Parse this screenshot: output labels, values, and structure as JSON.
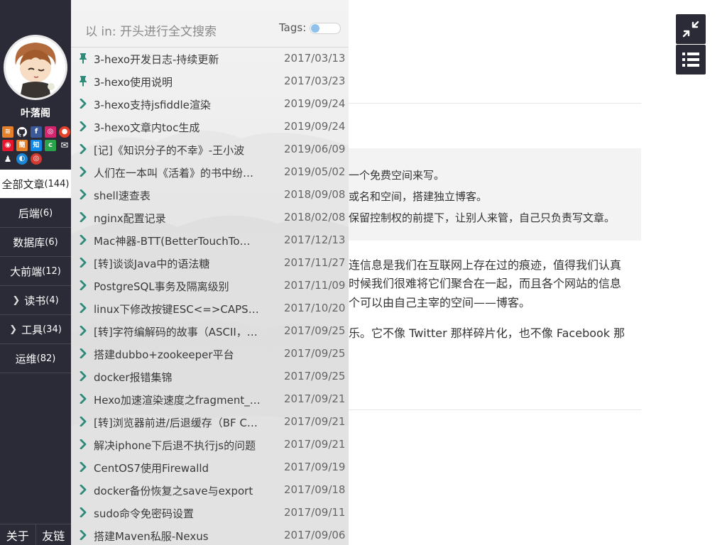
{
  "sidebar": {
    "site_name": "叶落阁",
    "social_row1": [
      {
        "icon": "rss-icon",
        "glyph": "≋",
        "color": "#e6802a"
      },
      {
        "icon": "github-icon",
        "glyph": "●",
        "color": "#2a2b36"
      },
      {
        "icon": "facebook-icon",
        "glyph": "f",
        "color": "#3b5998"
      },
      {
        "icon": "instagram-icon",
        "glyph": "◎",
        "color": "#d6256f"
      },
      {
        "icon": "reddit-icon",
        "glyph": "●",
        "color": "#e4422a"
      }
    ],
    "social_row2": [
      {
        "icon": "weibo-icon",
        "glyph": "◉",
        "color": "#e6162d"
      },
      {
        "icon": "douban-icon",
        "glyph": "簡",
        "color": "#e6802a"
      },
      {
        "icon": "zhihu-icon",
        "glyph": "知",
        "color": "#0f88eb"
      },
      {
        "icon": "csdn-icon",
        "glyph": "c",
        "color": "#2ba34b"
      },
      {
        "icon": "mail-icon",
        "glyph": "✉",
        "color": "#2a2b36"
      }
    ],
    "social_row3": [
      {
        "icon": "qq-icon",
        "glyph": "♟",
        "color": "#2a2b36"
      },
      {
        "icon": "segmentfault-icon",
        "glyph": "◐",
        "color": "#1b86d4"
      },
      {
        "icon": "netease-music-icon",
        "glyph": "◎",
        "color": "#d33a31"
      }
    ],
    "nav": [
      {
        "label": "全部文章",
        "count": "(144)",
        "active": true,
        "chevron": false
      },
      {
        "label": "后端",
        "count": "(6)",
        "active": false,
        "chevron": false
      },
      {
        "label": "数据库",
        "count": "(6)",
        "active": false,
        "chevron": false
      },
      {
        "label": "大前端",
        "count": "(12)",
        "active": false,
        "chevron": false
      },
      {
        "label": "读书",
        "count": "(4)",
        "active": false,
        "chevron": true
      },
      {
        "label": "工具",
        "count": "(34)",
        "active": false,
        "chevron": true
      },
      {
        "label": "运维",
        "count": "(82)",
        "active": false,
        "chevron": false
      }
    ],
    "bottom_links": [
      "关于",
      "友链"
    ]
  },
  "panel": {
    "search_placeholder": "以 in: 开头进行全文搜索",
    "tags_label": "Tags:",
    "tags_toggle_on": false,
    "posts": [
      {
        "title": "3-hexo开发日志-持续更新",
        "date": "2017/03/13",
        "pinned": true
      },
      {
        "title": "3-hexo使用说明",
        "date": "2017/03/23",
        "pinned": true
      },
      {
        "title": "3-hexo支持jsfiddle渲染",
        "date": "2019/09/24",
        "pinned": false
      },
      {
        "title": "3-hexo文章内toc生成",
        "date": "2019/09/24",
        "pinned": false
      },
      {
        "title": "[记]《知识分子的不幸》-王小波",
        "date": "2019/06/09",
        "pinned": false
      },
      {
        "title": "人们在一本叫《活着》的书中纷纷…",
        "date": "2019/05/02",
        "pinned": false
      },
      {
        "title": "shell速查表",
        "date": "2018/09/08",
        "pinned": false
      },
      {
        "title": "nginx配置记录",
        "date": "2018/02/08",
        "pinned": false
      },
      {
        "title": "Mac神器-BTT(BetterTouchTo…",
        "date": "2017/12/13",
        "pinned": false
      },
      {
        "title": "[转]谈谈Java中的语法糖",
        "date": "2017/11/27",
        "pinned": false
      },
      {
        "title": "PostgreSQL事务及隔离级别",
        "date": "2017/11/09",
        "pinned": false
      },
      {
        "title": "linux下修改按键ESC<=>CAPSL…",
        "date": "2017/10/20",
        "pinned": false
      },
      {
        "title": "[转]字符编解码的故事（ASCII，…",
        "date": "2017/09/25",
        "pinned": false
      },
      {
        "title": "搭建dubbo+zookeeper平台",
        "date": "2017/09/25",
        "pinned": false
      },
      {
        "title": "docker报错集锦",
        "date": "2017/09/25",
        "pinned": false
      },
      {
        "title": "Hexo加速渲染速度之fragment_…",
        "date": "2017/09/21",
        "pinned": false
      },
      {
        "title": "[转]浏览器前进/后退缓存（BF C…",
        "date": "2017/09/21",
        "pinned": false
      },
      {
        "title": "解决iphone下后退不执行js的问题",
        "date": "2017/09/21",
        "pinned": false
      },
      {
        "title": "CentOS7使用Firewalld",
        "date": "2017/09/19",
        "pinned": false
      },
      {
        "title": "docker备份恢复之save与export",
        "date": "2017/09/18",
        "pinned": false
      },
      {
        "title": "sudo命令免密码设置",
        "date": "2017/09/11",
        "pinned": false
      },
      {
        "title": "搭建Maven私服-Nexus",
        "date": "2017/09/06",
        "pinned": false
      }
    ]
  },
  "content": {
    "quote_lines": [
      "一个免费空间来写。",
      "或名和空间，搭建独立博客。",
      "保留控制权的前提下，让别人来管，自己只负责写文章。"
    ],
    "para1_lines": [
      "连信息是我们在互联网上存在过的痕迹，值得我们认真",
      "时候我们很难将它们聚合在一起，而且各个网站的信息",
      "个可以由自己主宰的空间——博客。"
    ],
    "para2_lines": [
      "乐。它不像 Twitter 那样碎片化，也不像 Facebook 那"
    ]
  },
  "toolbar": {
    "collapse_icon": "compress-icon",
    "toc_icon": "list-icon"
  }
}
